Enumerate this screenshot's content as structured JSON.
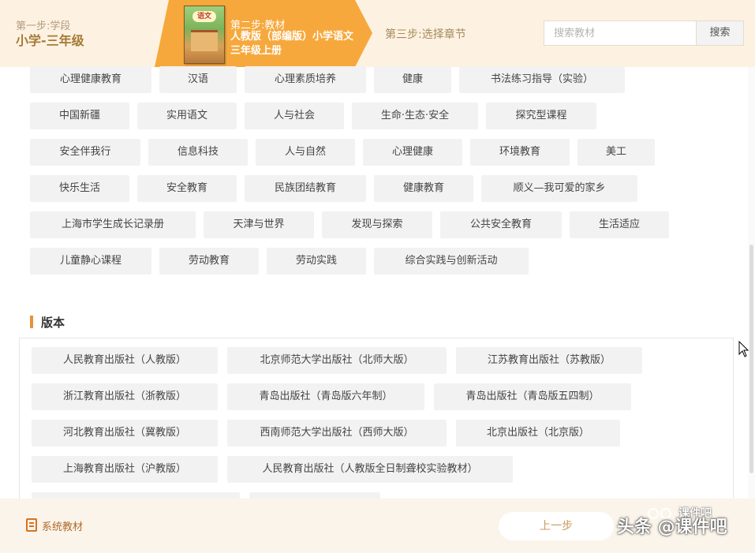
{
  "header": {
    "step1": {
      "label": "第一步:学段",
      "value": "小学-三年级"
    },
    "step2": {
      "label": "第二步:教材",
      "value": "人教版（部编版）小学语文三年级上册",
      "cover_badge": "语文"
    },
    "step3": {
      "label": "第三步:选择章节"
    },
    "search": {
      "placeholder": "搜索教材",
      "button_label": "搜索"
    }
  },
  "subject_tags": [
    "心理健康教育",
    "汉语",
    "心理素质培养",
    "健康",
    "书法练习指导（实验）",
    "中国新疆",
    "实用语文",
    "人与社会",
    "生命·生态·安全",
    "探究型课程",
    "安全伴我行",
    "信息科技",
    "人与自然",
    "心理健康",
    "环境教育",
    "美工",
    "快乐生活",
    "安全教育",
    "民族团结教育",
    "健康教育",
    "顺义—我可爱的家乡",
    "上海市学生成长记录册",
    "天津与世界",
    "发现与探索",
    "公共安全教育",
    "生活适应",
    "儿童静心课程",
    "劳动教育",
    "劳动实践",
    "综合实践与创新活动"
  ],
  "version_section": {
    "title": "版本",
    "publishers": [
      "人民教育出版社（人教版）",
      "北京师范大学出版社（北师大版）",
      "江苏教育出版社（苏教版）",
      "浙江教育出版社（浙教版）",
      "青岛出版社（青岛版六年制）",
      "青岛出版社（青岛版五四制）",
      "河北教育出版社（冀教版）",
      "西南师范大学出版社（西师大版）",
      "北京出版社（北京版）",
      "上海教育出版社（沪教版）",
      "人民教育出版社（人教版全日制聋校实验教材）"
    ]
  },
  "footer": {
    "system_label": "系统教材",
    "prev_button": "上一步",
    "watermark": "头条 @课件吧",
    "watermark_small": "课件吧"
  },
  "colors": {
    "accent": "#f2a33a",
    "header_bg": "#fdf2e2",
    "tag_bg": "#f2f2f2",
    "footer_bg": "#fbf4ea"
  }
}
